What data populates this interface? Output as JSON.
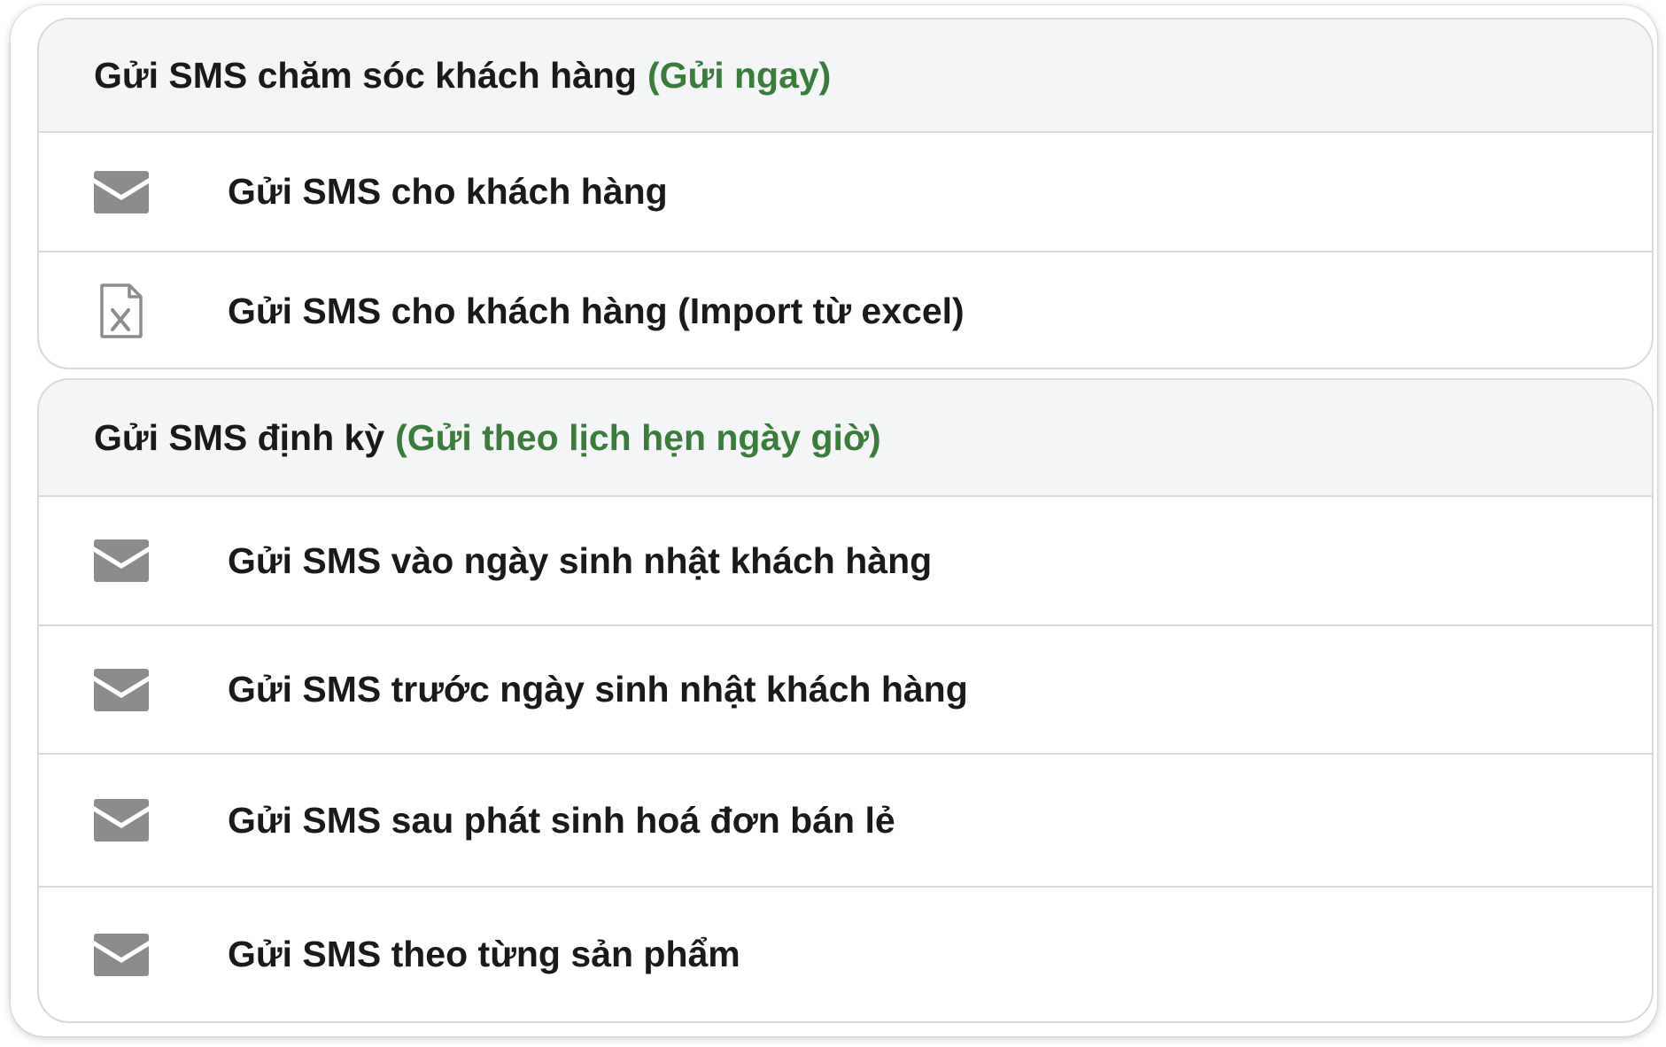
{
  "section1": {
    "title": "Gửi SMS chăm sóc khách hàng",
    "subtitle": "(Gửi ngay)",
    "items": [
      {
        "label": "Gửi SMS cho khách hàng",
        "icon": "envelope-icon"
      },
      {
        "label": "Gửi SMS cho khách hàng (Import từ excel)",
        "icon": "excel-file-icon"
      }
    ]
  },
  "section2": {
    "title": "Gửi SMS định kỳ",
    "subtitle": "(Gửi theo lịch hẹn ngày giờ)",
    "items": [
      {
        "label": "Gửi SMS vào ngày sinh nhật khách hàng",
        "icon": "envelope-icon"
      },
      {
        "label": "Gửi SMS trước ngày sinh nhật khách hàng",
        "icon": "envelope-icon"
      },
      {
        "label": "Gửi SMS sau phát sinh hoá đơn bán lẻ",
        "icon": "envelope-icon"
      },
      {
        "label": "Gửi SMS theo từng sản phẩm",
        "icon": "envelope-icon"
      }
    ]
  },
  "colors": {
    "accent": "#3a7d3a",
    "text": "#1a1a1a",
    "icon": "#8c8c8c",
    "header_bg": "#f4f5f7",
    "border": "#d9d9d9"
  }
}
